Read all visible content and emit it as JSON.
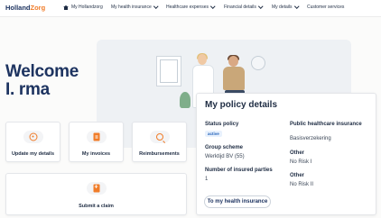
{
  "brand": {
    "part1": "Holland",
    "part2": "Zorg"
  },
  "nav": {
    "home": "My Hollandzorg",
    "items": [
      "My health insurance",
      "Healthcare expenses",
      "Financial details",
      "My details"
    ],
    "customer_services": "Customer services"
  },
  "welcome": {
    "line1": "Welcome",
    "line2": "I. rma"
  },
  "actions": [
    {
      "label": "Update my details",
      "icon": "user-circle-icon"
    },
    {
      "label": "My invoices",
      "icon": "invoice-icon"
    },
    {
      "label": "Reimbursements",
      "icon": "search-icon"
    },
    {
      "label": "Submit a claim",
      "icon": "add-document-icon"
    }
  ],
  "policy": {
    "title": "My policy details",
    "status_label": "Status policy",
    "status_value": "active",
    "group_label": "Group scheme",
    "group_value": "Werktijd BV (55)",
    "insured_label": "Number of insured parties",
    "insured_value": "1",
    "public_label": "Public healthcare insurance",
    "public_value": "Basisverzekering",
    "other1_label": "Other",
    "other1_value": "No Risk I",
    "other2_label": "Other",
    "other2_value": "No Risk II",
    "button": "To my health insurance"
  },
  "colors": {
    "brand_navy": "#1d3360",
    "accent_orange": "#f07c29",
    "status_blue": "#1f5fb8"
  }
}
